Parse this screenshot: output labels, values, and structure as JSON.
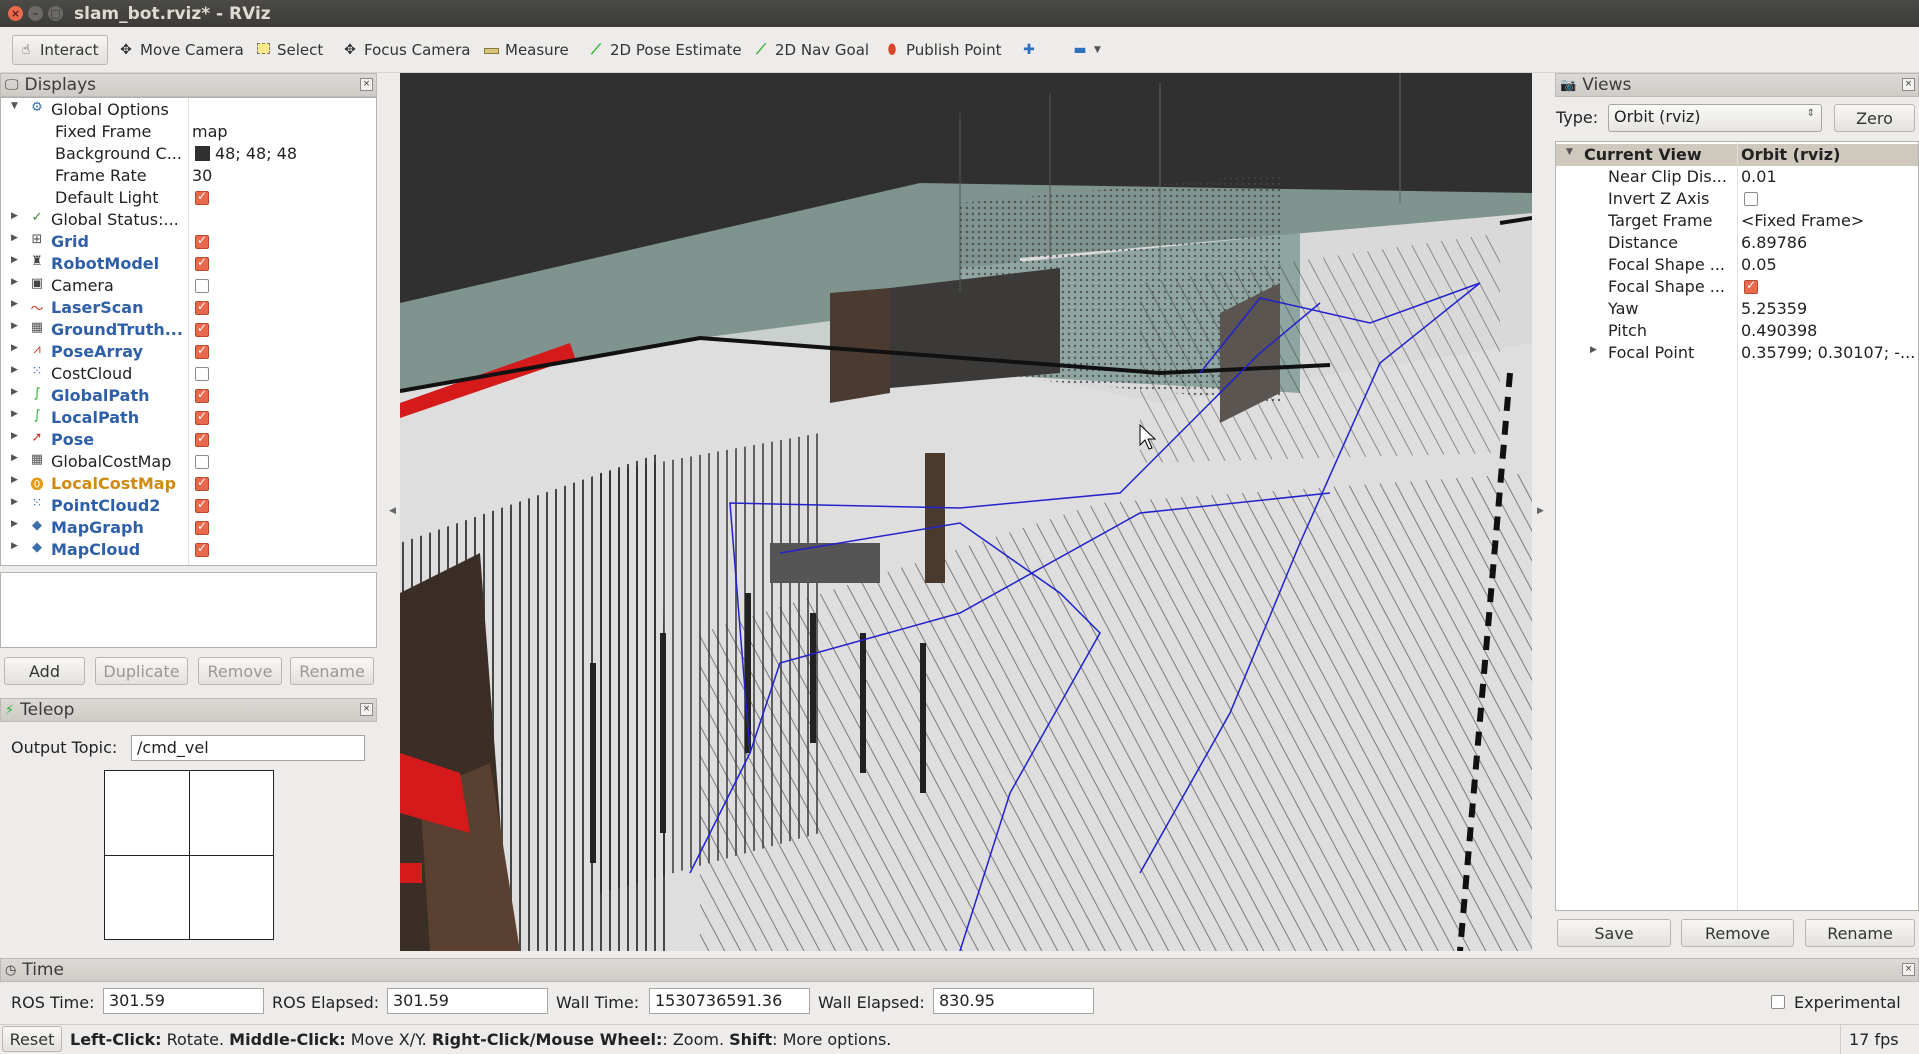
{
  "window": {
    "title": "slam_bot.rviz* - RViz"
  },
  "toolbar": {
    "tools": [
      {
        "label": "Interact",
        "icon": "hand-icon"
      },
      {
        "label": "Move Camera",
        "icon": "move-camera-icon"
      },
      {
        "label": "Select",
        "icon": "select-icon"
      },
      {
        "label": "Focus Camera",
        "icon": "focus-camera-icon"
      },
      {
        "label": "Measure",
        "icon": "measure-icon"
      },
      {
        "label": "2D Pose Estimate",
        "icon": "pose-arrow-icon"
      },
      {
        "label": "2D Nav Goal",
        "icon": "nav-arrow-icon"
      },
      {
        "label": "Publish Point",
        "icon": "map-pin-icon"
      }
    ]
  },
  "displays": {
    "title": "Displays",
    "rows": [
      {
        "label": "Global Options",
        "value": ""
      },
      {
        "label": "Fixed Frame",
        "value": "map"
      },
      {
        "label": "Background C...",
        "value": "48; 48; 48"
      },
      {
        "label": "Frame Rate",
        "value": "30"
      },
      {
        "label": "Default Light",
        "value": ""
      },
      {
        "label": "Global Status:...",
        "value": ""
      },
      {
        "label": "Grid",
        "value": ""
      },
      {
        "label": "RobotModel",
        "value": ""
      },
      {
        "label": "Camera",
        "value": ""
      },
      {
        "label": "LaserScan",
        "value": ""
      },
      {
        "label": "GroundTruth...",
        "value": ""
      },
      {
        "label": "PoseArray",
        "value": ""
      },
      {
        "label": "CostCloud",
        "value": ""
      },
      {
        "label": "GlobalPath",
        "value": ""
      },
      {
        "label": "LocalPath",
        "value": ""
      },
      {
        "label": "Pose",
        "value": ""
      },
      {
        "label": "GlobalCostMap",
        "value": ""
      },
      {
        "label": "LocalCostMap",
        "value": ""
      },
      {
        "label": "PointCloud2",
        "value": ""
      },
      {
        "label": "MapGraph",
        "value": ""
      },
      {
        "label": "MapCloud",
        "value": ""
      }
    ],
    "buttons": {
      "add": "Add",
      "duplicate": "Duplicate",
      "remove": "Remove",
      "rename": "Rename"
    }
  },
  "teleop": {
    "title": "Teleop",
    "output_topic_label": "Output Topic:",
    "output_topic_value": "/cmd_vel"
  },
  "views": {
    "title": "Views",
    "type_label": "Type:",
    "type_value": "Orbit (rviz)",
    "zero_label": "Zero",
    "header_name": "Current View",
    "header_value": "Orbit (rviz)",
    "rows": [
      {
        "label": "Near Clip Dis...",
        "value": "0.01"
      },
      {
        "label": "Invert Z Axis",
        "value": ""
      },
      {
        "label": "Target Frame",
        "value": "<Fixed Frame>"
      },
      {
        "label": "Distance",
        "value": "6.89786"
      },
      {
        "label": "Focal Shape ...",
        "value": "0.05"
      },
      {
        "label": "Focal Shape ...",
        "value": ""
      },
      {
        "label": "Yaw",
        "value": "5.25359"
      },
      {
        "label": "Pitch",
        "value": "0.490398"
      },
      {
        "label": "Focal Point",
        "value": "0.35799; 0.30107; -..."
      }
    ],
    "buttons": {
      "save": "Save",
      "remove": "Remove",
      "rename": "Rename"
    }
  },
  "time": {
    "title": "Time",
    "ros_time_label": "ROS Time:",
    "ros_time": "301.59",
    "ros_elapsed_label": "ROS Elapsed:",
    "ros_elapsed": "301.59",
    "wall_time_label": "Wall Time:",
    "wall_time": "1530736591.36",
    "wall_elapsed_label": "Wall Elapsed:",
    "wall_elapsed": "830.95",
    "experimental_label": "Experimental"
  },
  "status": {
    "reset": "Reset",
    "k1": "Left-Click:",
    "t1": " Rotate. ",
    "k2": "Middle-Click:",
    "t2": " Move X/Y. ",
    "k3": "Right-Click/Mouse Wheel:",
    "t3": ": Zoom. ",
    "k4": "Shift",
    "t4": ": More options.",
    "fps": "17 fps"
  },
  "colors": {
    "checked": "#e9694d",
    "display_link": "#2f5fa8",
    "warning_display": "#d08a14",
    "viewport_bg": "#303030",
    "path": "#2222cc"
  }
}
